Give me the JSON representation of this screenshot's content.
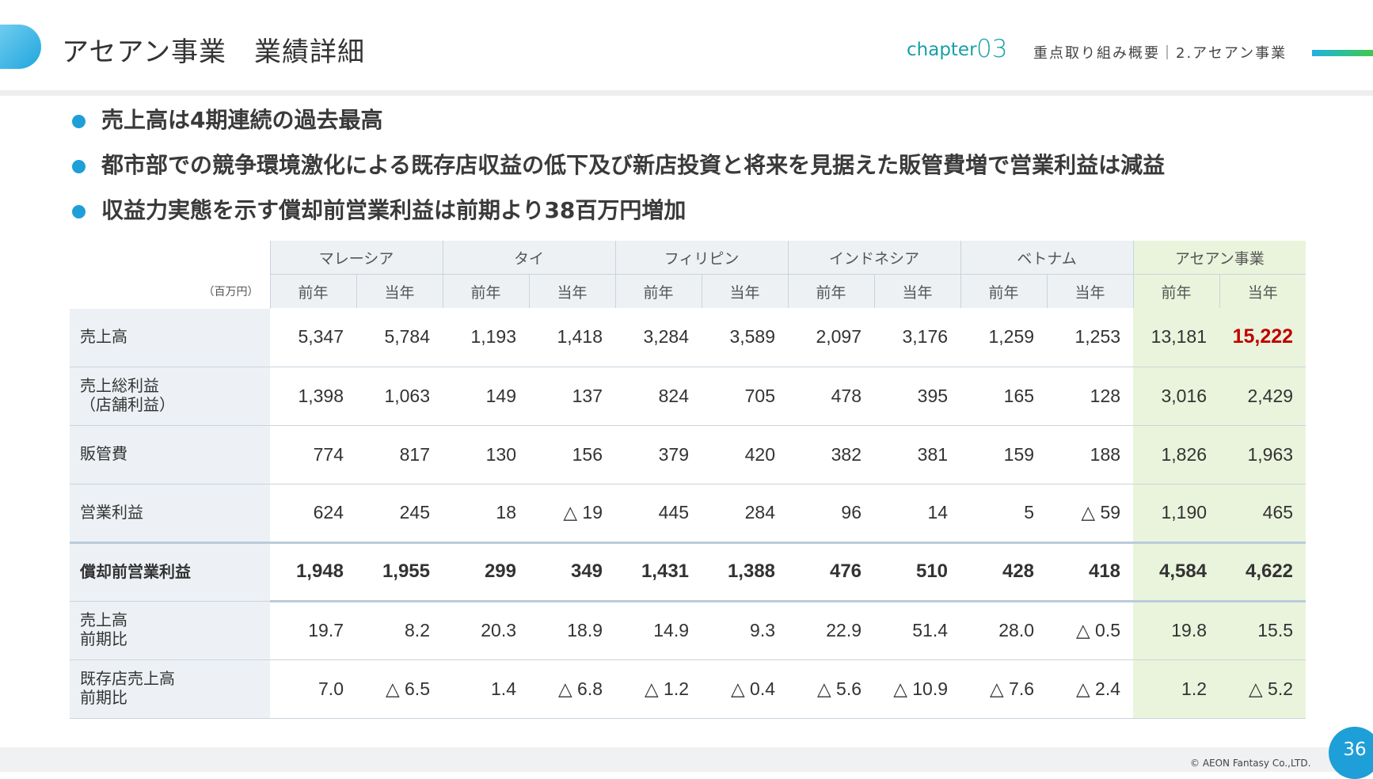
{
  "header": {
    "title": "アセアン事業　業績詳細",
    "chapter_label": "chapter",
    "chapter_number": "03",
    "section": "重点取り組み概要｜2.アセアン事業"
  },
  "bullets": [
    "売上高は4期連続の過去最高",
    "都市部での競争環境激化による既存店収益の低下及び新店投資と将来を見据えた販管費増で営業利益は減益",
    "収益力実態を示す償却前営業利益は前期より38百万円増加"
  ],
  "table": {
    "unit": "（百万円）",
    "regions": [
      "マレーシア",
      "タイ",
      "フィリピン",
      "インドネシア",
      "ベトナム",
      "アセアン事業"
    ],
    "year_labels": [
      "前年",
      "当年"
    ],
    "rows": [
      {
        "label": "売上高",
        "values": [
          "5,347",
          "5,784",
          "1,193",
          "1,418",
          "3,284",
          "3,589",
          "2,097",
          "3,176",
          "1,259",
          "1,253",
          "13,181",
          "15,222"
        ]
      },
      {
        "label": "売上総利益\n（店舗利益）",
        "values": [
          "1,398",
          "1,063",
          "149",
          "137",
          "824",
          "705",
          "478",
          "395",
          "165",
          "128",
          "3,016",
          "2,429"
        ]
      },
      {
        "label": "販管費",
        "values": [
          "774",
          "817",
          "130",
          "156",
          "379",
          "420",
          "382",
          "381",
          "159",
          "188",
          "1,826",
          "1,963"
        ]
      },
      {
        "label": "営業利益",
        "values": [
          "624",
          "245",
          "18",
          "△ 19",
          "445",
          "284",
          "96",
          "14",
          "5",
          "△ 59",
          "1,190",
          "465"
        ]
      },
      {
        "label": "償却前営業利益",
        "values": [
          "1,948",
          "1,955",
          "299",
          "349",
          "1,431",
          "1,388",
          "476",
          "510",
          "428",
          "418",
          "4,584",
          "4,622"
        ]
      },
      {
        "label": "売上高\n前期比",
        "values": [
          "19.7",
          "8.2",
          "20.3",
          "18.9",
          "14.9",
          "9.3",
          "22.9",
          "51.4",
          "28.0",
          "△ 0.5",
          "19.8",
          "15.5"
        ]
      },
      {
        "label": "既存店売上高\n前期比",
        "values": [
          "7.0",
          "△ 6.5",
          "1.4",
          "△ 6.8",
          "△ 1.2",
          "△ 0.4",
          "△ 5.6",
          "△ 10.9",
          "△ 7.6",
          "△ 2.4",
          "1.2",
          "△ 5.2"
        ]
      }
    ]
  },
  "footer": {
    "copyright": "© AEON Fantasy Co.,LTD.",
    "page_number": "36"
  },
  "colors": {
    "accent_blue": "#1e9fd8",
    "chapter_teal": "#17a0a6",
    "asean_column_bg": "#eaf4dc",
    "highlight_red": "#c00000"
  }
}
